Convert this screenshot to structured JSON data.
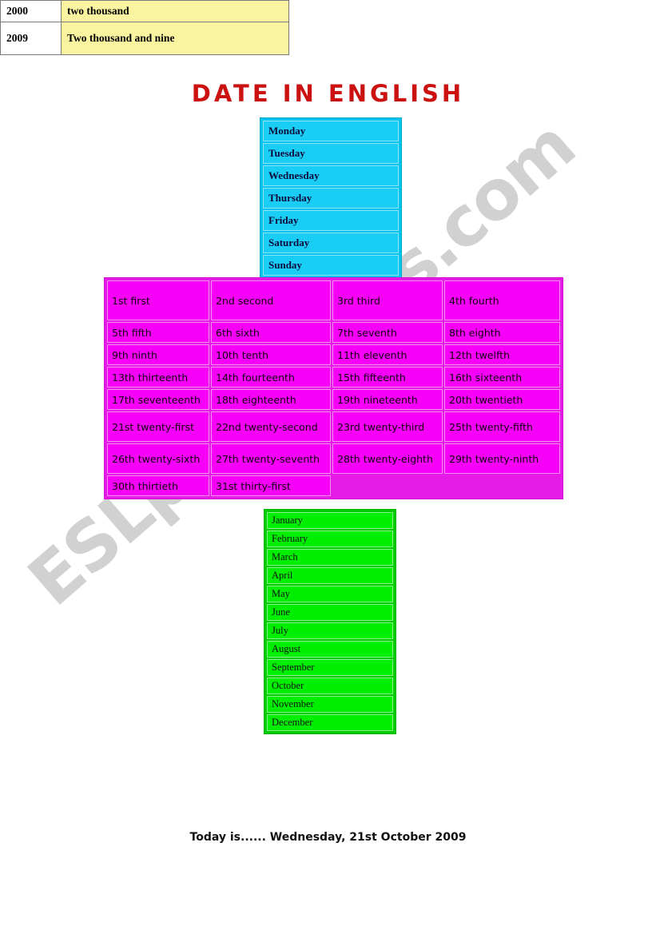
{
  "page": {
    "title": "DATE IN ENGLISH",
    "watermark": "ESLprintables.com",
    "footer": "Today is......  Wednesday, 21st October 2009",
    "colors": {
      "title": "#cc1111",
      "days_bg": "#19cdf5",
      "ordinals_bg": "#f700f7",
      "months_bg": "#00ef00",
      "years_bg": "#faf4a0",
      "watermark": "#c9c9c9"
    }
  },
  "days": {
    "items": [
      "Monday",
      "Tuesday",
      "Wednesday",
      "Thursday",
      "Friday",
      "Saturday",
      "Sunday"
    ]
  },
  "ordinals": {
    "rows": [
      [
        "1st first",
        "2nd second",
        "3rd third",
        "4th fourth"
      ],
      [
        "5th fifth",
        "6th sixth",
        "7th seventh",
        "8th eighth"
      ],
      [
        "9th ninth",
        "10th tenth",
        "11th eleventh",
        "12th twelfth"
      ],
      [
        "13th thirteenth",
        "14th fourteenth",
        "15th fifteenth",
        "16th sixteenth"
      ],
      [
        "17th seventeenth",
        "18th eighteenth",
        "19th nineteenth",
        "20th twentieth"
      ],
      [
        "21st twenty-first",
        "22nd twenty-second",
        "23rd twenty-third",
        "25th twenty-fifth"
      ],
      [
        "26th twenty-sixth",
        "27th twenty-seventh",
        "28th twenty-eighth",
        "29th twenty-ninth"
      ],
      [
        "30th thirtieth",
        "31st thirty-first",
        "",
        ""
      ]
    ]
  },
  "months": {
    "items": [
      "January",
      "February",
      "March",
      "April",
      "May",
      "June",
      "July",
      "August",
      "September",
      "October",
      "November",
      "December"
    ]
  },
  "years": {
    "rows": [
      {
        "number": "2000",
        "words": "two thousand"
      },
      {
        "number": "2009",
        "words": "Two thousand and nine"
      }
    ]
  }
}
